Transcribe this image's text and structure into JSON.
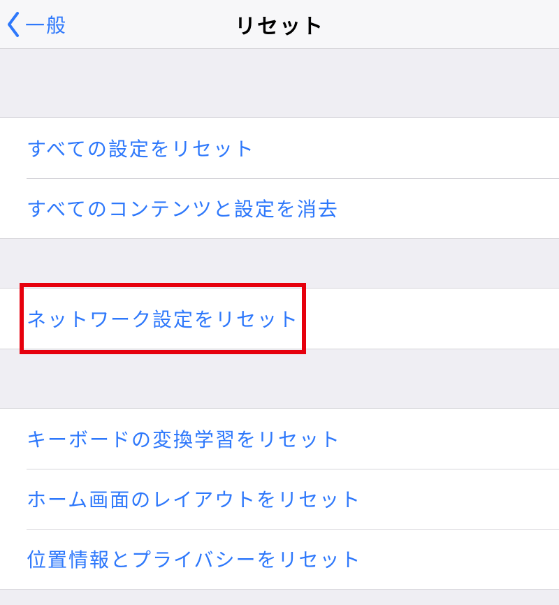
{
  "nav": {
    "back_label": "一般",
    "title": "リセット"
  },
  "groups": [
    {
      "rows": [
        {
          "label": "すべての設定をリセット",
          "name": "reset-all-settings"
        },
        {
          "label": "すべてのコンテンツと設定を消去",
          "name": "erase-all-content-settings"
        }
      ]
    },
    {
      "rows": [
        {
          "label": "ネットワーク設定をリセット",
          "name": "reset-network-settings",
          "highlighted": true
        }
      ]
    },
    {
      "rows": [
        {
          "label": "キーボードの変換学習をリセット",
          "name": "reset-keyboard-dictionary"
        },
        {
          "label": "ホーム画面のレイアウトをリセット",
          "name": "reset-home-screen-layout"
        },
        {
          "label": "位置情報とプライバシーをリセット",
          "name": "reset-location-privacy"
        }
      ]
    }
  ],
  "colors": {
    "accent": "#2e78fb",
    "highlight": "#e6000d",
    "background": "#efeef3"
  }
}
